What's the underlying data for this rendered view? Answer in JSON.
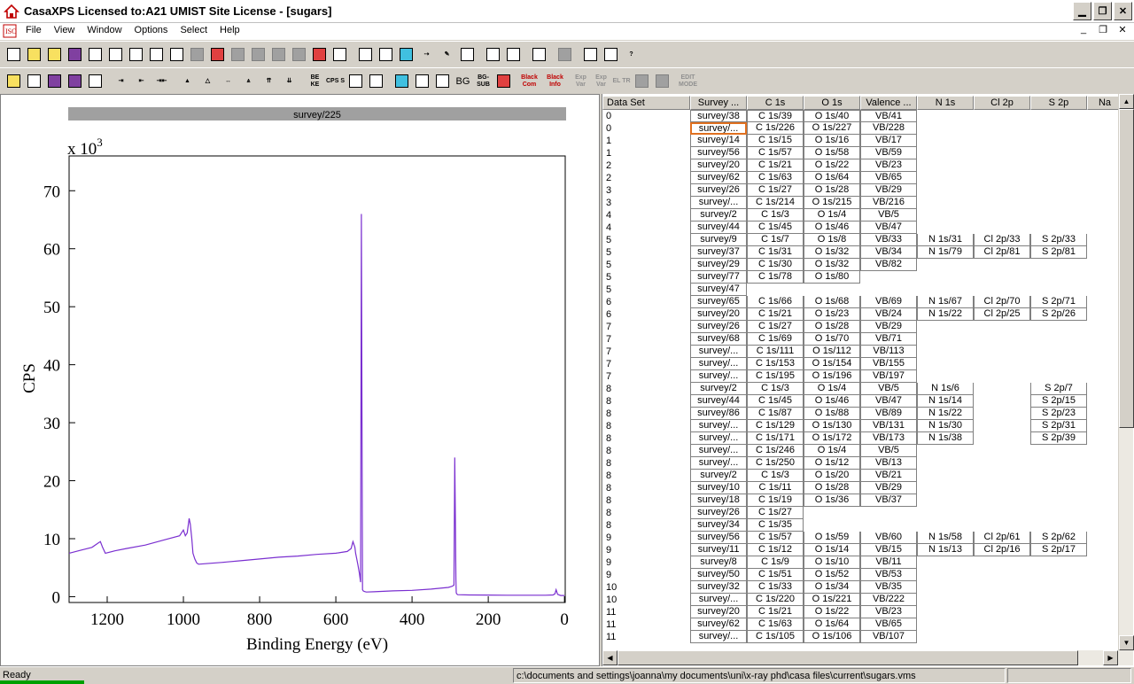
{
  "window": {
    "title": "CasaXPS Licensed to:A21 UMIST Site License  - [sugars]"
  },
  "menu": [
    "File",
    "View",
    "Window",
    "Options",
    "Select",
    "Help"
  ],
  "toolbar2_labels": {
    "be_ke": "BE KE",
    "cps_s": "CPS S",
    "bg": "BG",
    "bg_sub": "BG- SUB",
    "black_com": "Black Com",
    "black_info": "Black Info",
    "exp_var": "Exp Var",
    "exp_var2": "Exp Var",
    "el_tr": "EL TR",
    "edit_mode": "EDIT MODE"
  },
  "plot": {
    "title": "survey/225",
    "multiplier": "x 10",
    "multiplier_exp": "3",
    "ylabel": "CPS",
    "xlabel": "Binding Energy (eV)",
    "line_color": "#7a2fd0"
  },
  "chart_data": {
    "type": "line",
    "title": "survey/225",
    "xlabel": "Binding Energy (eV)",
    "ylabel": "CPS",
    "xlim": [
      1300,
      -2
    ],
    "ylim": [
      -1,
      76
    ],
    "xticks": [
      1200,
      1000,
      800,
      600,
      400,
      200,
      0
    ],
    "yticks": [
      0,
      10,
      20,
      30,
      40,
      50,
      60,
      70
    ],
    "series": [
      {
        "x": [
          1300,
          1270,
          1240,
          1225,
          1218,
          1212,
          1205,
          1180,
          1150,
          1100,
          1050,
          1010,
          1000,
          995,
          990,
          985,
          982,
          978,
          975,
          970,
          965,
          960,
          900,
          850,
          800,
          750,
          700,
          650,
          600,
          570,
          560,
          555,
          550,
          548,
          545,
          542,
          538,
          535,
          533,
          531,
          530,
          528,
          525,
          520,
          500,
          450,
          400,
          350,
          320,
          305,
          295,
          290,
          288,
          286,
          285,
          284,
          283,
          280,
          250,
          200,
          150,
          100,
          50,
          30,
          25,
          22,
          18,
          10,
          0
        ],
        "y": [
          7.5,
          8.0,
          8.5,
          9.2,
          9.5,
          8.5,
          7.5,
          7.9,
          8.3,
          8.9,
          9.8,
          10.5,
          11.5,
          10.5,
          11.0,
          13.5,
          12.5,
          10.0,
          7.5,
          6.5,
          5.8,
          5.6,
          5.9,
          6.2,
          6.5,
          6.8,
          7.0,
          7.3,
          7.5,
          7.8,
          8.3,
          9.5,
          8.5,
          7.5,
          6.5,
          5.5,
          4.0,
          2.5,
          66.0,
          20.0,
          1.2,
          1.0,
          0.9,
          0.8,
          0.85,
          1.0,
          1.1,
          1.3,
          1.5,
          1.6,
          1.8,
          2.0,
          24.0,
          12.0,
          3.0,
          0.7,
          0.5,
          0.35,
          0.3,
          0.28,
          0.26,
          0.25,
          0.25,
          0.3,
          0.5,
          1.2,
          0.4,
          0.2,
          0.2
        ]
      }
    ]
  },
  "table": {
    "columns": [
      "Data Set",
      "Survey ...",
      "C 1s",
      "O 1s",
      "Valence ...",
      "N 1s",
      "Cl 2p",
      "S 2p",
      "Na"
    ],
    "rows": [
      [
        "0",
        "survey/38",
        "C 1s/39",
        "O 1s/40",
        "VB/41",
        "",
        "",
        ""
      ],
      [
        "0",
        "survey/...",
        "C 1s/226",
        "O 1s/227",
        "VB/228",
        "",
        "",
        ""
      ],
      [
        "1",
        "survey/14",
        "C 1s/15",
        "O 1s/16",
        "VB/17",
        "",
        "",
        ""
      ],
      [
        "1",
        "survey/56",
        "C 1s/57",
        "O 1s/58",
        "VB/59",
        "",
        "",
        ""
      ],
      [
        "2",
        "survey/20",
        "C 1s/21",
        "O 1s/22",
        "VB/23",
        "",
        "",
        ""
      ],
      [
        "2",
        "survey/62",
        "C 1s/63",
        "O 1s/64",
        "VB/65",
        "",
        "",
        ""
      ],
      [
        "3",
        "survey/26",
        "C 1s/27",
        "O 1s/28",
        "VB/29",
        "",
        "",
        ""
      ],
      [
        "3",
        "survey/...",
        "C 1s/214",
        "O 1s/215",
        "VB/216",
        "",
        "",
        ""
      ],
      [
        "4",
        "survey/2",
        "C 1s/3",
        "O 1s/4",
        "VB/5",
        "",
        "",
        ""
      ],
      [
        "4",
        "survey/44",
        "C 1s/45",
        "O 1s/46",
        "VB/47",
        "",
        "",
        ""
      ],
      [
        "5",
        "survey/9",
        "C 1s/7",
        "O 1s/8",
        "VB/33",
        "N 1s/31",
        "Cl 2p/33",
        "S 2p/33"
      ],
      [
        "5",
        "survey/37",
        "C 1s/31",
        "O 1s/32",
        "VB/34",
        "N 1s/79",
        "Cl 2p/81",
        "S 2p/81"
      ],
      [
        "5",
        "survey/29",
        "C 1s/30",
        "O 1s/32",
        "VB/82",
        "",
        "",
        ""
      ],
      [
        "5",
        "survey/77",
        "C 1s/78",
        "O 1s/80",
        "",
        "",
        "",
        ""
      ],
      [
        "5",
        "survey/47",
        "",
        "",
        "",
        "",
        "",
        ""
      ],
      [
        "6",
        "survey/65",
        "C 1s/66",
        "O 1s/68",
        "VB/69",
        "N 1s/67",
        "Cl 2p/70",
        "S 2p/71"
      ],
      [
        "6",
        "survey/20",
        "C 1s/21",
        "O 1s/23",
        "VB/24",
        "N 1s/22",
        "Cl 2p/25",
        "S 2p/26"
      ],
      [
        "7",
        "survey/26",
        "C 1s/27",
        "O 1s/28",
        "VB/29",
        "",
        "",
        ""
      ],
      [
        "7",
        "survey/68",
        "C 1s/69",
        "O 1s/70",
        "VB/71",
        "",
        "",
        ""
      ],
      [
        "7",
        "survey/...",
        "C 1s/111",
        "O 1s/112",
        "VB/113",
        "",
        "",
        ""
      ],
      [
        "7",
        "survey/...",
        "C 1s/153",
        "O 1s/154",
        "VB/155",
        "",
        "",
        ""
      ],
      [
        "7",
        "survey/...",
        "C 1s/195",
        "O 1s/196",
        "VB/197",
        "",
        "",
        ""
      ],
      [
        "8",
        "survey/2",
        "C 1s/3",
        "O 1s/4",
        "VB/5",
        "N 1s/6",
        "",
        "S 2p/7"
      ],
      [
        "8",
        "survey/44",
        "C 1s/45",
        "O 1s/46",
        "VB/47",
        "N 1s/14",
        "",
        "S 2p/15"
      ],
      [
        "8",
        "survey/86",
        "C 1s/87",
        "O 1s/88",
        "VB/89",
        "N 1s/22",
        "",
        "S 2p/23"
      ],
      [
        "8",
        "survey/...",
        "C 1s/129",
        "O 1s/130",
        "VB/131",
        "N 1s/30",
        "",
        "S 2p/31"
      ],
      [
        "8",
        "survey/...",
        "C 1s/171",
        "O 1s/172",
        "VB/173",
        "N 1s/38",
        "",
        "S 2p/39"
      ],
      [
        "8",
        "survey/...",
        "C 1s/246",
        "O 1s/4",
        "VB/5",
        "",
        "",
        ""
      ],
      [
        "8",
        "survey/...",
        "C 1s/250",
        "O 1s/12",
        "VB/13",
        "",
        "",
        ""
      ],
      [
        "8",
        "survey/2",
        "C 1s/3",
        "O 1s/20",
        "VB/21",
        "",
        "",
        ""
      ],
      [
        "8",
        "survey/10",
        "C 1s/11",
        "O 1s/28",
        "VB/29",
        "",
        "",
        ""
      ],
      [
        "8",
        "survey/18",
        "C 1s/19",
        "O 1s/36",
        "VB/37",
        "",
        "",
        ""
      ],
      [
        "8",
        "survey/26",
        "C 1s/27",
        "",
        "",
        "",
        "",
        ""
      ],
      [
        "8",
        "survey/34",
        "C 1s/35",
        "",
        "",
        "",
        "",
        ""
      ],
      [
        "9",
        "survey/56",
        "C 1s/57",
        "O 1s/59",
        "VB/60",
        "N 1s/58",
        "Cl 2p/61",
        "S 2p/62"
      ],
      [
        "9",
        "survey/11",
        "C 1s/12",
        "O 1s/14",
        "VB/15",
        "N 1s/13",
        "Cl 2p/16",
        "S 2p/17"
      ],
      [
        "9",
        "survey/8",
        "C 1s/9",
        "O 1s/10",
        "VB/11",
        "",
        "",
        ""
      ],
      [
        "9",
        "survey/50",
        "C 1s/51",
        "O 1s/52",
        "VB/53",
        "",
        "",
        ""
      ],
      [
        "10",
        "survey/32",
        "C 1s/33",
        "O 1s/34",
        "VB/35",
        "",
        "",
        ""
      ],
      [
        "10",
        "survey/...",
        "C 1s/220",
        "O 1s/221",
        "VB/222",
        "",
        "",
        ""
      ],
      [
        "11",
        "survey/20",
        "C 1s/21",
        "O 1s/22",
        "VB/23",
        "",
        "",
        ""
      ],
      [
        "11",
        "survey/62",
        "C 1s/63",
        "O 1s/64",
        "VB/65",
        "",
        "",
        ""
      ],
      [
        "11",
        "survey/...",
        "C 1s/105",
        "O 1s/106",
        "VB/107",
        "",
        "",
        ""
      ]
    ],
    "selected": {
      "row": 1,
      "col": 1
    }
  },
  "status": {
    "left": "Ready",
    "path": "c:\\documents and settings\\joanna\\my documents\\uni\\x-ray phd\\casa files\\current\\sugars.vms"
  }
}
